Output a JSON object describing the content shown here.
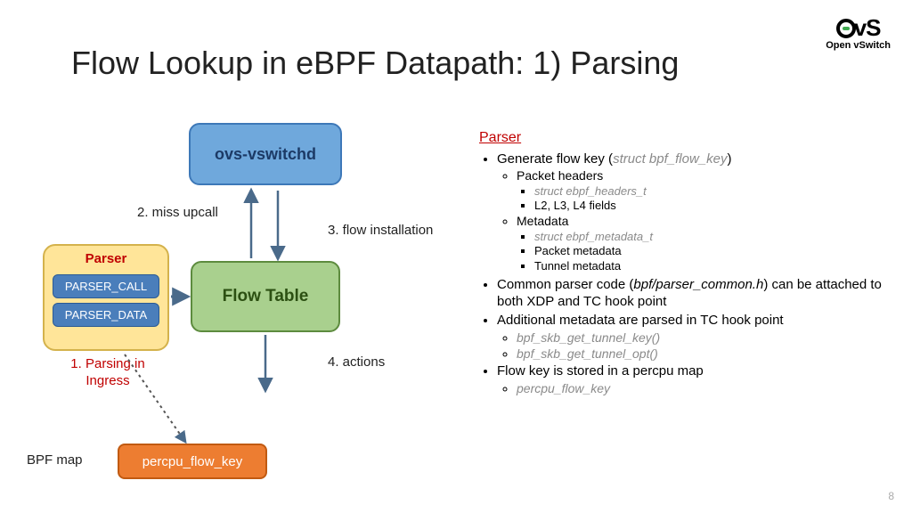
{
  "logo": {
    "top": "OvS",
    "sub": "Open vSwitch"
  },
  "title": "Flow Lookup in eBPF Datapath: 1) Parsing",
  "diagram": {
    "vswitchd": "ovs-vswitchd",
    "flowtable": "Flow Table",
    "parser_box_header": "Parser",
    "parser_call": "PARSER_CALL",
    "parser_data": "PARSER_DATA",
    "percpu": "percpu_flow_key",
    "labels": {
      "parsing_ingress": "1. Parsing in\nIngress",
      "miss_upcall": "2. miss upcall",
      "flow_install": "3. flow installation",
      "actions": "4. actions",
      "bpf_map": "BPF map"
    }
  },
  "right": {
    "header": "Parser",
    "b1": "Generate flow key (",
    "b1_code": "struct bpf_flow_key",
    "b1_end": ")",
    "b1a": "Packet headers",
    "b1a_i": "struct ebpf_headers_t",
    "b1a_ii": "L2, L3, L4 fields",
    "b1b": "Metadata",
    "b1b_i": "struct ebpf_metadata_t",
    "b1b_ii": "Packet metadata",
    "b1b_iii": "Tunnel metadata",
    "b2_pre": "Common parser code (",
    "b2_code": "bpf/parser_common.h",
    "b2_post": ") can be attached to both XDP and TC hook point",
    "b3": "Additional metadata are parsed in TC hook point",
    "b3_i": "bpf_skb_get_tunnel_key()",
    "b3_ii": "bpf_skb_get_tunnel_opt()",
    "b4": "Flow key is stored in a percpu map",
    "b4_i": "percpu_flow_key"
  },
  "page_number": "8"
}
